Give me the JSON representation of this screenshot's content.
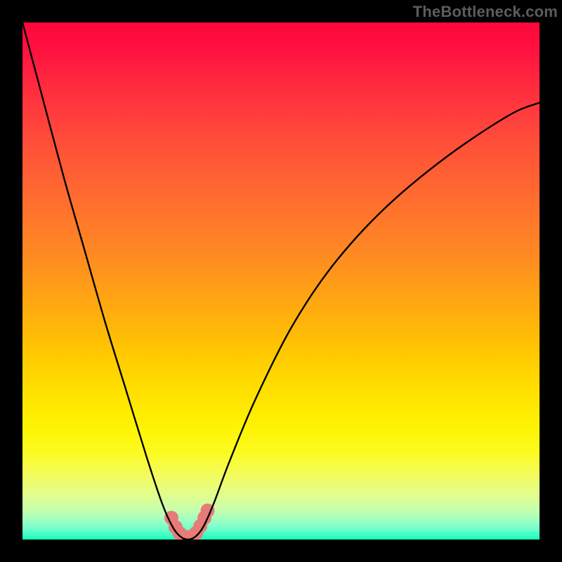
{
  "attribution": "TheBottleneck.com",
  "chart_data": {
    "type": "line",
    "title": "",
    "xlabel": "",
    "ylabel": "",
    "xlim": [
      0,
      100
    ],
    "ylim": [
      0,
      100
    ],
    "grid": false,
    "legend": false,
    "annotations": [],
    "series": [
      {
        "name": "bottleneck-curve",
        "x": [
          0,
          4,
          8,
          12,
          16,
          20,
          24,
          27,
          29,
          30.5,
          32,
          33.5,
          35,
          37,
          40,
          45,
          52,
          60,
          70,
          82,
          94,
          100
        ],
        "values": [
          100,
          85,
          70,
          56,
          42,
          29,
          16,
          7,
          2.5,
          0.6,
          0,
          0.6,
          2.5,
          7,
          15,
          27,
          41,
          53,
          64,
          74,
          82,
          84.5
        ]
      }
    ],
    "markers": [
      {
        "x": 28.8,
        "y": 4.2
      },
      {
        "x": 29.6,
        "y": 2.4
      },
      {
        "x": 30.4,
        "y": 1.2
      },
      {
        "x": 31.2,
        "y": 0.6
      },
      {
        "x": 32.0,
        "y": 0.4
      },
      {
        "x": 32.8,
        "y": 0.6
      },
      {
        "x": 33.6,
        "y": 1.3
      },
      {
        "x": 34.4,
        "y": 2.6
      },
      {
        "x": 35.2,
        "y": 4.2
      },
      {
        "x": 35.8,
        "y": 5.6
      }
    ]
  }
}
